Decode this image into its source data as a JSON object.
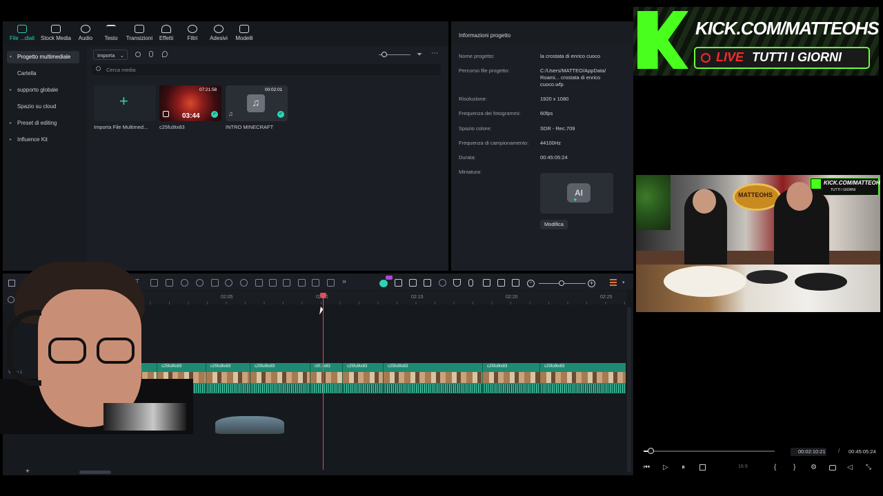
{
  "toolbar": {
    "items": [
      {
        "label": "File ...diali",
        "icon": "media-icon"
      },
      {
        "label": "Stock Media",
        "icon": "stock-icon"
      },
      {
        "label": "Audio",
        "icon": "music-icon"
      },
      {
        "label": "Testo",
        "icon": "text-icon"
      },
      {
        "label": "Transizioni",
        "icon": "transition-icon"
      },
      {
        "label": "Effetti",
        "icon": "effects-icon"
      },
      {
        "label": "Filtri",
        "icon": "filter-icon"
      },
      {
        "label": "Adesivi",
        "icon": "sticker-icon"
      },
      {
        "label": "Modelli",
        "icon": "template-icon"
      }
    ]
  },
  "sidebar": {
    "items": [
      {
        "label": "Progetto multimediale"
      },
      {
        "label": "Cartella"
      },
      {
        "label": "supporto globale"
      },
      {
        "label": "Spazio su cloud"
      },
      {
        "label": "Preset di editing"
      },
      {
        "label": "Influence Kit"
      }
    ]
  },
  "media": {
    "import_label": "Importa",
    "search_placeholder": "Cerca media",
    "items": [
      {
        "name": "Importa File Multimed...",
        "duration": ""
      },
      {
        "name": "c25fu9tx83",
        "duration": "07:21:58",
        "thumb_text": "03:44"
      },
      {
        "name": "INTRO MINECRAFT",
        "duration": "00:02:01"
      }
    ]
  },
  "info": {
    "title": "Informazioni progetto",
    "rows": [
      {
        "label": "Nome progetto:",
        "value": "la crostata di enrico cuoco"
      },
      {
        "label": "Percorso file progetto:",
        "value": "C:/Users/MATTEO/AppData/ Roami... crostata di enrico cuoco.wfp"
      },
      {
        "label": "Risoluzione:",
        "value": "1920 x 1080"
      },
      {
        "label": "Frequenza dei fotogrammi:",
        "value": "60fps"
      },
      {
        "label": "Spazio colore:",
        "value": "SDR - Rec.709"
      },
      {
        "label": "Frequenza di campionamento:",
        "value": "44100Hz"
      },
      {
        "label": "Durata:",
        "value": "00:45:05:24"
      },
      {
        "label": "Miniatura:",
        "value": ""
      }
    ],
    "edit_label": "Modifica",
    "thumb_text": "AI"
  },
  "banner": {
    "logo": "K",
    "line1": "KICK.COM/MATTEOHS",
    "line2_live": "LIVE",
    "line2_rest": "TUTTI I GIORNI"
  },
  "preview": {
    "current_time": "00:02:10:21",
    "separator": "/",
    "total_time": "00:45:05:24",
    "progress": 0.05,
    "ratio": "16:9",
    "overlay_banner": "KICK.COM/MATTEOHS",
    "overlay_sub": "TUTTI I GIORNI",
    "scene_sign": "MATTEOHS"
  },
  "timeline": {
    "ruler": [
      "02:05",
      "02:10",
      "02:15",
      "02:20",
      "02:25"
    ],
    "track_label": "Video 1",
    "clips": [
      {
        "label": "83"
      },
      {
        "label": "c25fu9tx83"
      },
      {
        "label": "c25fu9tx83"
      },
      {
        "label": "c25fu9tx83"
      },
      {
        "label": "c5f..tx83"
      },
      {
        "label": "c25fu9tx83"
      },
      {
        "label": "c25fu9tx83"
      },
      {
        "label": "c25fu9tx83"
      },
      {
        "label": "c25fu9tx83"
      }
    ]
  },
  "colors": {
    "accent": "#2fd3b3",
    "playhead": "#e0505c",
    "panel": "#1b1e24",
    "clip": "#1f8a73"
  }
}
